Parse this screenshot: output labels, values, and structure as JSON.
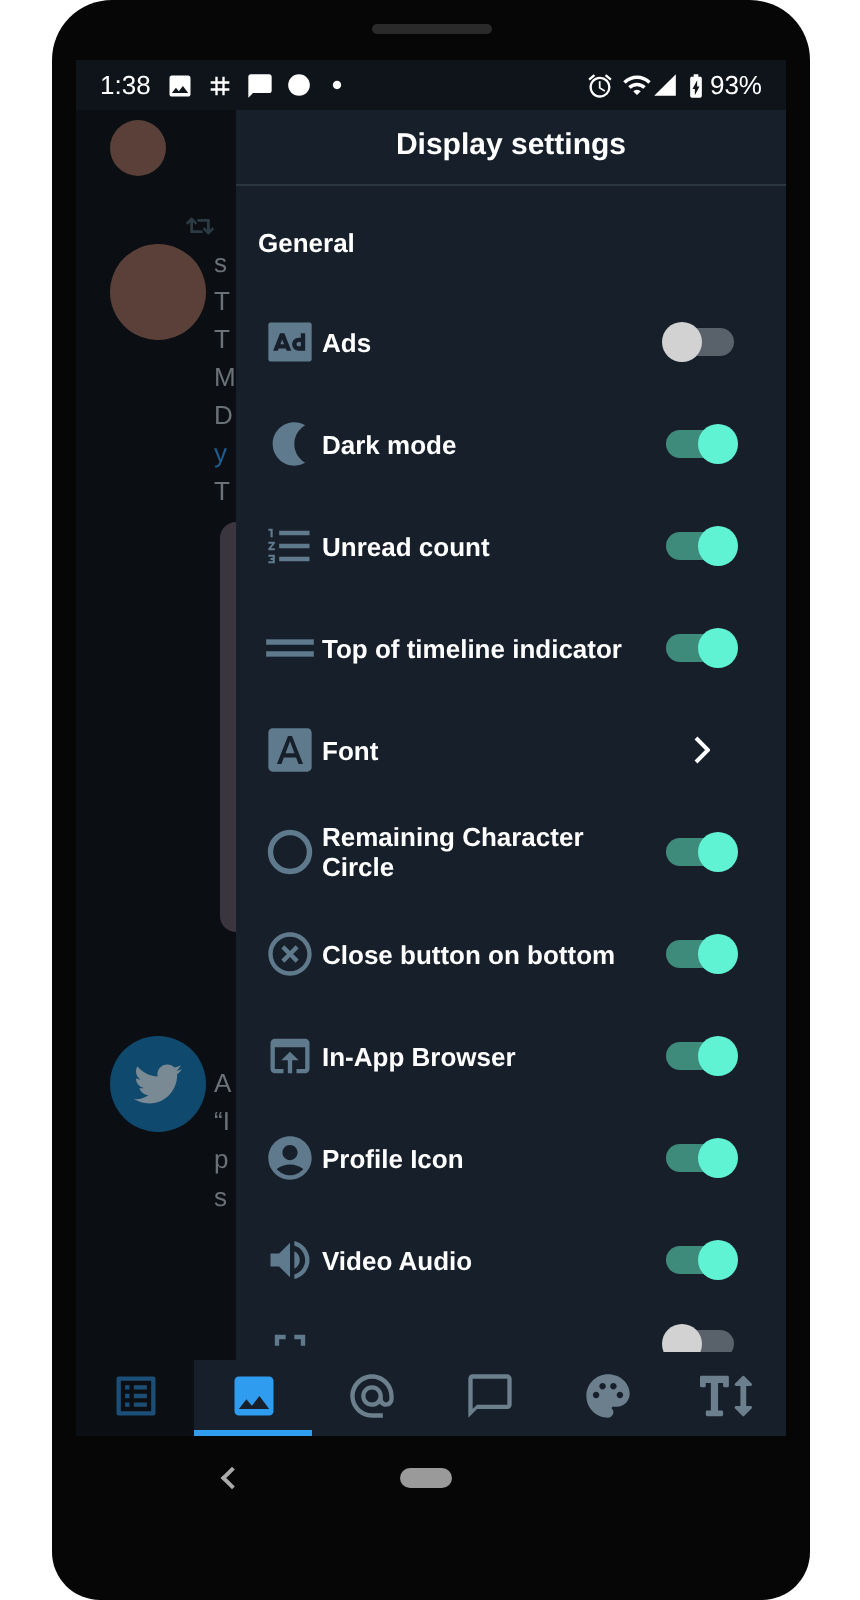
{
  "status_bar": {
    "time": "1:38",
    "battery": "93%"
  },
  "background": {
    "letters": [
      "s",
      "T",
      "T",
      "M",
      "D",
      "y",
      "T"
    ],
    "letters_2": [
      "A",
      "“I",
      "p",
      "s"
    ]
  },
  "panel": {
    "title": "Display settings",
    "section": "General",
    "rows": [
      {
        "kind": "toggle",
        "label": "Ads",
        "on": false
      },
      {
        "kind": "toggle",
        "label": "Dark mode",
        "on": true
      },
      {
        "kind": "toggle",
        "label": "Unread count",
        "on": true
      },
      {
        "kind": "toggle",
        "label": "Top of timeline indicator",
        "on": true
      },
      {
        "kind": "link",
        "label": "Font"
      },
      {
        "kind": "toggle",
        "label": "Remaining Character Circle",
        "on": true
      },
      {
        "kind": "toggle",
        "label": "Close button on bottom",
        "on": true
      },
      {
        "kind": "toggle",
        "label": "In-App Browser",
        "on": true
      },
      {
        "kind": "toggle",
        "label": "Profile Icon",
        "on": true
      },
      {
        "kind": "toggle",
        "label": "Video Audio",
        "on": true
      }
    ],
    "partial_row": {
      "on": false
    }
  },
  "bottom_tabs": [
    {
      "selected": false
    },
    {
      "selected": true
    },
    {
      "selected": false
    },
    {
      "selected": false
    },
    {
      "selected": false
    },
    {
      "selected": false
    }
  ]
}
